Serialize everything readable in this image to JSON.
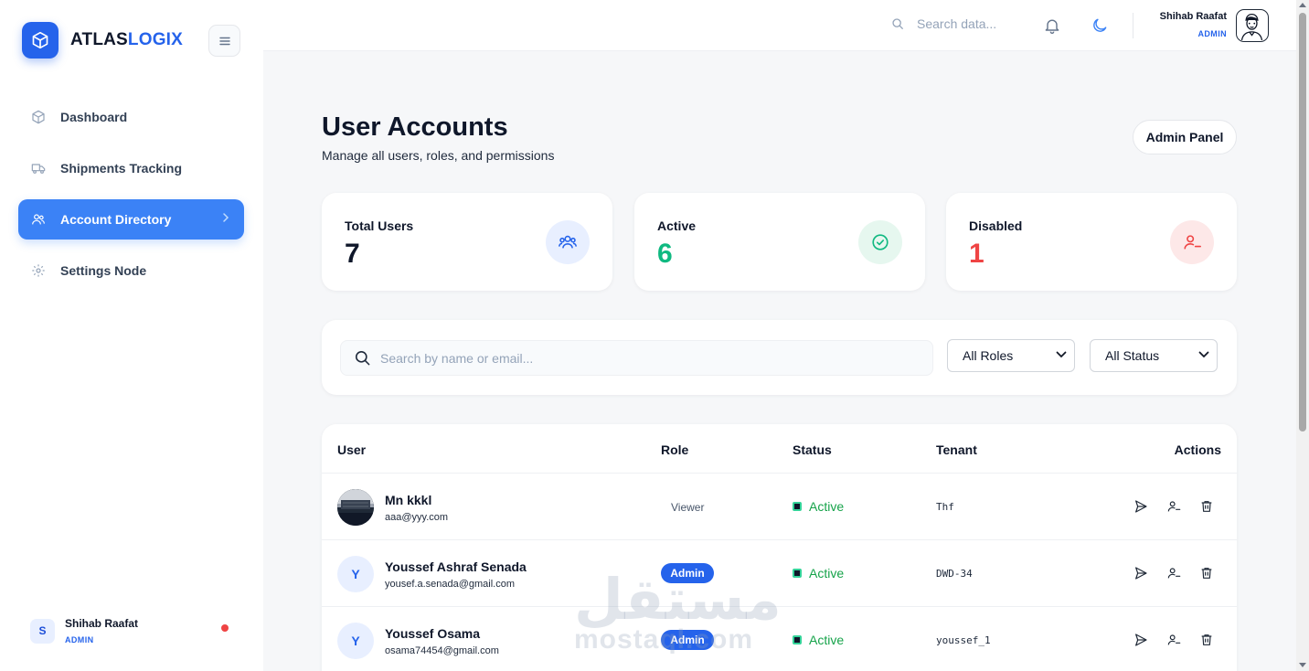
{
  "brand": {
    "part1": "ATLAS",
    "part2": "LOGIX",
    "accent_color": "#2563eb"
  },
  "sidebar": {
    "items": [
      {
        "label": "Dashboard",
        "icon": "cube-icon",
        "active": false
      },
      {
        "label": "Shipments Tracking",
        "icon": "truck-icon",
        "active": false
      },
      {
        "label": "Account Directory",
        "icon": "users-icon",
        "active": true
      },
      {
        "label": "Settings Node",
        "icon": "gear-icon",
        "active": false
      }
    ],
    "user": {
      "initial": "S",
      "name": "Shihab Raafat",
      "role": "ADMIN",
      "status_color": "#ef4444"
    }
  },
  "topbar": {
    "search_placeholder": "Search data...",
    "user": {
      "name": "Shihab Raafat",
      "role": "ADMIN"
    }
  },
  "page": {
    "title": "User Accounts",
    "subtitle": "Manage all users, roles, and permissions",
    "admin_panel_label": "Admin Panel"
  },
  "stats": [
    {
      "label": "Total Users",
      "value": "7",
      "color": "#0f172a",
      "icon": "users-icon"
    },
    {
      "label": "Active",
      "value": "6",
      "color": "#10b981",
      "icon": "check-circle-icon"
    },
    {
      "label": "Disabled",
      "value": "1",
      "color": "#ef4444",
      "icon": "user-minus-icon"
    }
  ],
  "filters": {
    "search_placeholder": "Search by name or email...",
    "role_selected": "All Roles",
    "status_selected": "All Status"
  },
  "table": {
    "columns": [
      "User",
      "Role",
      "Status",
      "Tenant",
      "Actions"
    ],
    "rows": [
      {
        "avatar": "photo",
        "initial": "",
        "name": "Mn kkkl",
        "email": "aaa@yyy.com",
        "role": "Viewer",
        "role_style": "plain",
        "status": "Active",
        "tenant": "Thf"
      },
      {
        "avatar": "initial",
        "initial": "Y",
        "name": "Youssef Ashraf Senada",
        "email": "yousef.a.senada@gmail.com",
        "role": "Admin",
        "role_style": "badge",
        "status": "Active",
        "tenant": "DWD-34"
      },
      {
        "avatar": "initial",
        "initial": "Y",
        "name": "Youssef Osama",
        "email": "osama74454@gmail.com",
        "role": "Admin",
        "role_style": "badge",
        "status": "Active",
        "tenant": "youssef_1"
      }
    ]
  },
  "watermark": {
    "arabic": "مستقل",
    "latin": "mostaql.com"
  }
}
